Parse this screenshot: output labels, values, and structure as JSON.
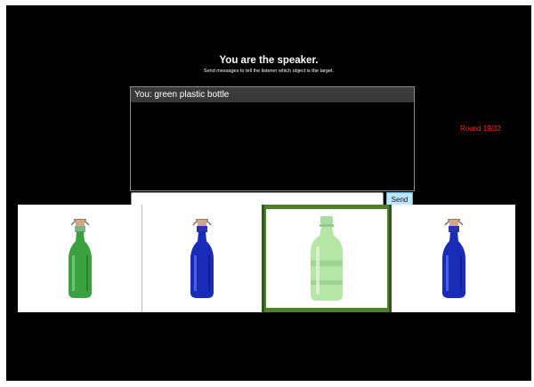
{
  "header": {
    "title": "You are the speaker.",
    "instructions": "Send messages to tell the listener which object is the target."
  },
  "status": {
    "round": "Round 19/32",
    "round_color": "#ff2a1a"
  },
  "chat": {
    "messages": [
      {
        "text": "You: green plastic bottle"
      }
    ],
    "input_value": "",
    "send_label": "Send"
  },
  "objects": [
    {
      "name": "green glass swing-top bottle",
      "target": false
    },
    {
      "name": "blue glass swing-top bottle",
      "target": false
    },
    {
      "name": "green plastic bottle",
      "target": true
    },
    {
      "name": "blue glass swing-top bottle",
      "target": false
    }
  ],
  "colors": {
    "target_border": "#4f7f2b",
    "background": "#000000",
    "send_button": "#bfe6ff"
  }
}
